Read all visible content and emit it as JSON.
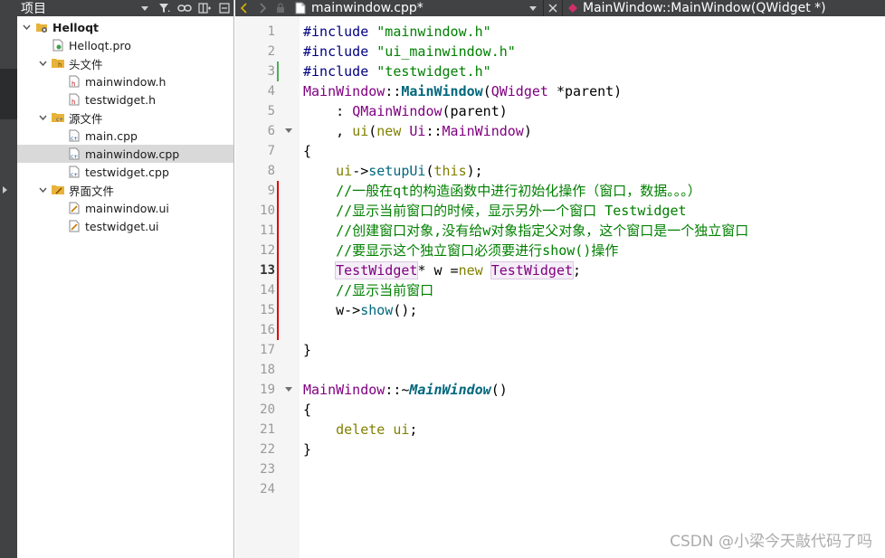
{
  "project_pane": {
    "title": "项目",
    "tree": [
      {
        "label": "Helloqt",
        "depth": 0,
        "expanded": true,
        "icon": "project-icon",
        "bold": true
      },
      {
        "label": "Helloqt.pro",
        "depth": 1,
        "icon": "pro-file-icon"
      },
      {
        "label": "头文件",
        "depth": 1,
        "expanded": true,
        "icon": "header-folder-icon"
      },
      {
        "label": "mainwindow.h",
        "depth": 2,
        "icon": "header-file-icon"
      },
      {
        "label": "testwidget.h",
        "depth": 2,
        "icon": "header-file-icon"
      },
      {
        "label": "源文件",
        "depth": 1,
        "expanded": true,
        "icon": "source-folder-icon"
      },
      {
        "label": "main.cpp",
        "depth": 2,
        "icon": "cpp-file-icon"
      },
      {
        "label": "mainwindow.cpp",
        "depth": 2,
        "icon": "cpp-file-icon",
        "selected": true
      },
      {
        "label": "testwidget.cpp",
        "depth": 2,
        "icon": "cpp-file-icon"
      },
      {
        "label": "界面文件",
        "depth": 1,
        "expanded": true,
        "icon": "forms-folder-icon"
      },
      {
        "label": "mainwindow.ui",
        "depth": 2,
        "icon": "ui-file-icon"
      },
      {
        "label": "testwidget.ui",
        "depth": 2,
        "icon": "ui-file-icon"
      }
    ]
  },
  "editor": {
    "file_tab": "mainwindow.cpp*",
    "symbol_tab": "MainWindow::MainWindow(QWidget *)",
    "current_line": 13,
    "line_numbers": [
      "1",
      "2",
      "3",
      "4",
      "5",
      "6",
      "7",
      "8",
      "9",
      "10",
      "11",
      "12",
      "13",
      "14",
      "15",
      "16",
      "17",
      "18",
      "19",
      "20",
      "21",
      "22",
      "23",
      "24"
    ],
    "lines": [
      [
        {
          "t": "#include ",
          "c": "pp"
        },
        {
          "t": "\"mainwindow.h\"",
          "c": "str"
        }
      ],
      [
        {
          "t": "#include ",
          "c": "pp"
        },
        {
          "t": "\"ui_mainwindow.h\"",
          "c": "str"
        }
      ],
      [
        {
          "t": "#include ",
          "c": "pp"
        },
        {
          "t": "\"testwidget.h\"",
          "c": "str"
        }
      ],
      [
        {
          "t": "MainWindow",
          "c": "cls"
        },
        {
          "t": "::",
          "c": ""
        },
        {
          "t": "MainWindow",
          "c": "fnb"
        },
        {
          "t": "(",
          "c": ""
        },
        {
          "t": "QWidget",
          "c": "cls"
        },
        {
          "t": " *parent)",
          "c": ""
        }
      ],
      [
        {
          "t": "    : ",
          "c": ""
        },
        {
          "t": "QMainWindow",
          "c": "cls"
        },
        {
          "t": "(parent)",
          "c": ""
        }
      ],
      [
        {
          "t": "    , ",
          "c": ""
        },
        {
          "t": "ui",
          "c": "kw"
        },
        {
          "t": "(",
          "c": ""
        },
        {
          "t": "new ",
          "c": "kw"
        },
        {
          "t": "Ui",
          "c": "cls"
        },
        {
          "t": "::",
          "c": ""
        },
        {
          "t": "MainWindow",
          "c": "cls"
        },
        {
          "t": ")",
          "c": ""
        }
      ],
      [
        {
          "t": "{",
          "c": ""
        }
      ],
      [
        {
          "t": "    ui",
          "c": "kw"
        },
        {
          "t": "->",
          "c": ""
        },
        {
          "t": "setupUi",
          "c": "fn"
        },
        {
          "t": "(",
          "c": ""
        },
        {
          "t": "this",
          "c": "kw"
        },
        {
          "t": ");",
          "c": ""
        }
      ],
      [
        {
          "t": "    //一般在qt的构造函数中进行初始化操作（窗口，数据。。。）",
          "c": "cm"
        }
      ],
      [
        {
          "t": "    //显示当前窗口的时候，显示另外一个窗口 Testwidget",
          "c": "cm"
        }
      ],
      [
        {
          "t": "    //创建窗口对象,没有给w对象指定父对象，这个窗口是一个独立窗口",
          "c": "cm"
        }
      ],
      [
        {
          "t": "    //要显示这个独立窗口必须要进行show()操作",
          "c": "cm"
        }
      ],
      [
        {
          "t": "    ",
          "c": ""
        },
        {
          "t": "TestWidget",
          "c": "cls hl"
        },
        {
          "t": "* w =",
          "c": ""
        },
        {
          "t": "new ",
          "c": "kw"
        },
        {
          "t": "TestWidget",
          "c": "cls hl"
        },
        {
          "t": ";",
          "c": ""
        }
      ],
      [
        {
          "t": "    //显示当前窗口",
          "c": "cm"
        }
      ],
      [
        {
          "t": "    w->",
          "c": ""
        },
        {
          "t": "show",
          "c": "fn"
        },
        {
          "t": "();",
          "c": ""
        }
      ],
      [],
      [
        {
          "t": "}",
          "c": ""
        }
      ],
      [],
      [
        {
          "t": "MainWindow",
          "c": "cls"
        },
        {
          "t": "::~",
          "c": ""
        },
        {
          "t": "MainWindow",
          "c": "fni"
        },
        {
          "t": "()",
          "c": ""
        }
      ],
      [
        {
          "t": "{",
          "c": ""
        }
      ],
      [
        {
          "t": "    delete ",
          "c": "kw"
        },
        {
          "t": "ui",
          "c": "kw"
        },
        {
          "t": ";",
          "c": ""
        }
      ],
      [
        {
          "t": "}",
          "c": ""
        }
      ],
      [],
      []
    ],
    "fold_lines": [
      6,
      19
    ],
    "saved_change_lines": [
      3
    ],
    "unsaved_change_lines": [
      9,
      10,
      11,
      12,
      13,
      14,
      15,
      16
    ]
  },
  "colors": {
    "toolbar_bg": "#404244",
    "saved_change": "#4caf50",
    "unsaved_change": "#e00000"
  },
  "watermark": "CSDN @小梁今天敲代码了吗"
}
